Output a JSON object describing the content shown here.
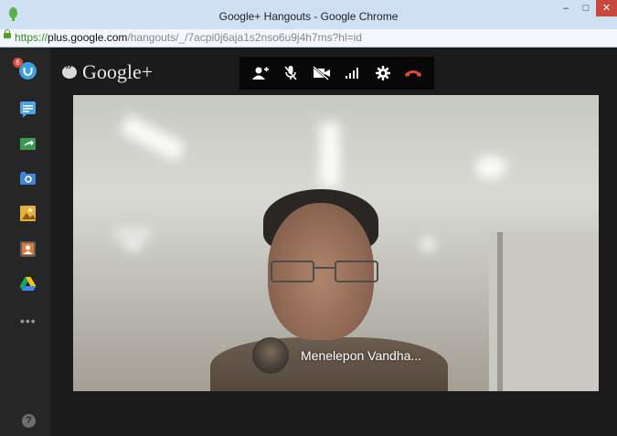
{
  "window": {
    "title": "Google+ Hangouts - Google Chrome",
    "controls": [
      "–",
      "□",
      "✕"
    ]
  },
  "address": {
    "scheme": "https://",
    "host": "plus.google.com",
    "path": "/hangouts/_/7acpi0j6aja1s2nso6u9j4h7ms?hl=id"
  },
  "brand": {
    "logo_text": "Google+"
  },
  "sidebar": {
    "items": [
      {
        "icon": "hangouts-app-icon",
        "color": "#3aa0e0"
      },
      {
        "icon": "chat-app-icon",
        "color": "#4aa3e8"
      },
      {
        "icon": "screenshare-app-icon",
        "color": "#3b9a52"
      },
      {
        "icon": "capture-app-icon",
        "color": "#3f86d6"
      },
      {
        "icon": "effects-app-icon",
        "color": "#e7b03a"
      },
      {
        "icon": "cameo-app-icon",
        "color": "#e07a3a"
      },
      {
        "icon": "drive-app-icon",
        "color": "#2e8fd8"
      }
    ],
    "more_label": "•••",
    "help_label": "?",
    "notification_badge": "6"
  },
  "toolbar": {
    "buttons": [
      "invite-people-icon",
      "mute-mic-icon",
      "turn-off-camera-icon",
      "bandwidth-icon",
      "settings-icon",
      "end-call-icon"
    ]
  },
  "call": {
    "caller_name": "Menelepon Vandha..."
  },
  "colors": {
    "end_call": "#e0463a",
    "sidebar_bg": "#262626",
    "main_bg": "#1b1b1b"
  }
}
